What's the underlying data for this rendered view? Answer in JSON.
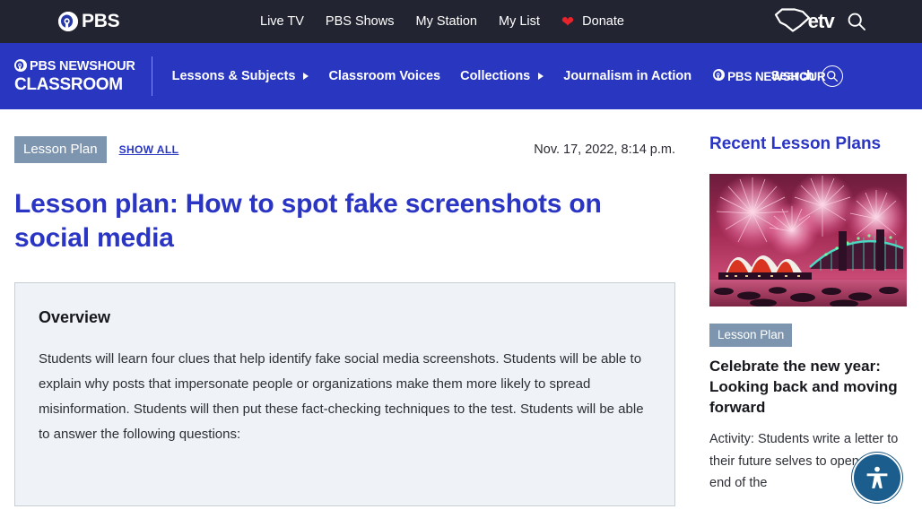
{
  "topbar": {
    "brand": {
      "name": "PBS",
      "icon": "pbs-head-logo"
    },
    "nav": [
      {
        "label": "Live TV"
      },
      {
        "label": "PBS Shows"
      },
      {
        "label": "My Station"
      },
      {
        "label": "My List"
      }
    ],
    "donate": {
      "label": "Donate",
      "icon": "heart-icon",
      "color": "#e8232a"
    },
    "station": {
      "label": "etv",
      "icon": "south-carolina-outline-icon"
    },
    "search_icon": "search-icon",
    "background": "#222431"
  },
  "bluenav": {
    "logo": {
      "line1": "PBS NEWSHOUR",
      "line2": "CLASSROOM",
      "icon": "pbs-head-logo"
    },
    "links": [
      {
        "label": "Lessons & Subjects",
        "has_caret": true
      },
      {
        "label": "Classroom Voices",
        "has_caret": false
      },
      {
        "label": "Collections",
        "has_caret": true
      },
      {
        "label": "Journalism in Action",
        "has_caret": false
      }
    ],
    "newshour_link": "PBS NEWSHOUR",
    "search_label": "Search",
    "search_icon": "search-icon",
    "background": "#2836c0"
  },
  "article": {
    "badge": "Lesson Plan",
    "show_all": "SHOW ALL",
    "date": "Nov. 17, 2022, 8:14 p.m.",
    "title": "Lesson plan: How to spot fake screenshots on social media",
    "overview_heading": "Overview",
    "overview_body": "Students will learn four clues that help identify fake social media screenshots. Students will be able to explain why posts that impersonate people or organizations make them more likely to spread misinformation. Students will then put these fact-checking techniques to the test. Students will be able to answer the following questions:",
    "title_color": "#2b35c4",
    "badge_color": "#7d95ae"
  },
  "sidebar": {
    "heading": "Recent Lesson Plans",
    "cards": [
      {
        "image_alt": "Fireworks over the Sydney Opera House and Harbour Bridge at night",
        "badge": "Lesson Plan",
        "title": "Celebrate the new year: Looking back and moving forward",
        "description": "Activity: Students write a letter to their future selves to open at the end of the"
      }
    ]
  },
  "accessibility_widget": {
    "icon": "accessibility-person-icon",
    "color": "#1b5e8e"
  }
}
